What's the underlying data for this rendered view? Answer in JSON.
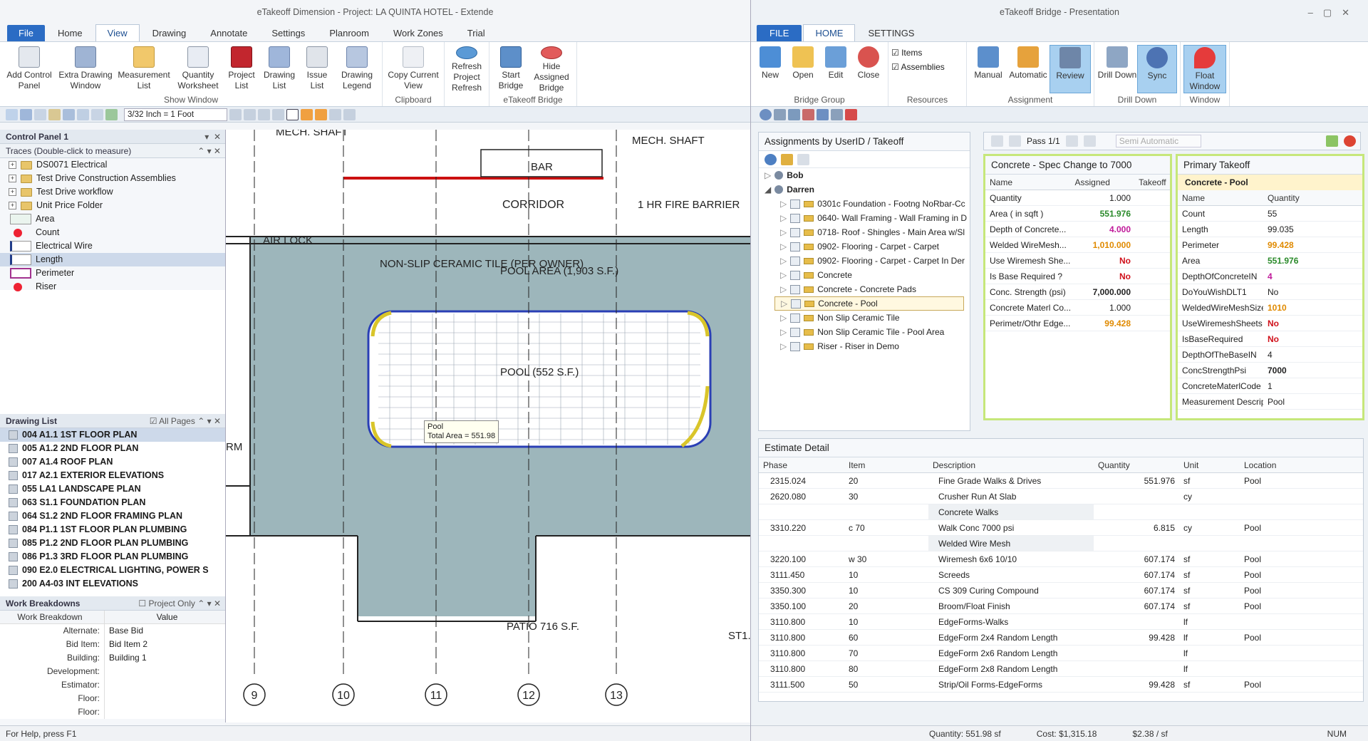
{
  "left_window": {
    "title": "eTakeoff Dimension - Project: LA QUINTA HOTEL - Extende",
    "tabs": [
      "File",
      "Home",
      "View",
      "Drawing",
      "Annotate",
      "Settings",
      "Planroom",
      "Work Zones",
      "Trial"
    ],
    "active_tab": "View",
    "ribbon": {
      "show_window": {
        "label": "Show Window",
        "buttons": [
          "Add Control Panel",
          "Extra Drawing Window",
          "Measurement List",
          "Quantity Worksheet",
          "Project List",
          "Drawing List",
          "Issue List",
          "Drawing Legend"
        ]
      },
      "clipboard": {
        "label": "Clipboard",
        "buttons": [
          "Copy Current View"
        ]
      },
      "refresh": {
        "label": "Refresh",
        "buttons": [
          "Refresh Project Refresh"
        ]
      },
      "etakeoff_bridge": {
        "label": "eTakeoff Bridge",
        "buttons": [
          "Start Bridge",
          "Hide Assigned Bridge"
        ]
      }
    },
    "scale": "3/32 Inch = 1 Foot",
    "control_panel": {
      "title": "Control Panel 1"
    },
    "traces": {
      "title": "Traces (Double-click to measure)",
      "folders": [
        "DS0071 Electrical",
        "Test Drive Construction Assemblies",
        "Test Drive workflow",
        "Unit Price Folder"
      ],
      "items": [
        {
          "label": "Area",
          "kind": "area"
        },
        {
          "label": "Count",
          "kind": "count"
        },
        {
          "label": "Electrical Wire",
          "kind": "line"
        },
        {
          "label": "Length",
          "kind": "line"
        },
        {
          "label": "Perimeter",
          "kind": "perimeter"
        },
        {
          "label": "Riser",
          "kind": "count"
        }
      ]
    },
    "drawing_list": {
      "title": "Drawing List",
      "all_pages": "All Pages",
      "items": [
        "004 A1.1 1ST FLOOR PLAN",
        "005 A1.2 2ND FLOOR PLAN",
        "007 A1.4 ROOF PLAN",
        "017 A2.1 EXTERIOR ELEVATIONS",
        "055 LA1 LANDSCAPE PLAN",
        "063 S1.1 FOUNDATION PLAN",
        "064 S1.2 2ND FLOOR FRAMING PLAN",
        "084 P1.1 1ST FLOOR PLAN PLUMBING",
        "085 P1.2 2ND FLOOR PLAN PLUMBING",
        "086 P1.3 3RD FLOOR PLAN PLUMBING",
        "090 E2.0 ELECTRICAL LIGHTING, POWER S",
        "200 A4-03 INT ELEVATIONS"
      ]
    },
    "work_breakdowns": {
      "title": "Work Breakdowns",
      "project_only": "Project Only",
      "col1": "Work Breakdown",
      "col2": "Value",
      "rows": [
        [
          "Alternate:",
          "Base Bid"
        ],
        [
          "Bid Item:",
          "Bid Item 2"
        ],
        [
          "Building:",
          "Building 1"
        ],
        [
          "Development:",
          ""
        ],
        [
          "Estimator:",
          ""
        ],
        [
          "Floor:",
          ""
        ],
        [
          "Floor:",
          ""
        ]
      ]
    },
    "status": "For Help, press F1",
    "drawing": {
      "labels": {
        "mech_shaft_l": "MECH. SHAFT",
        "mech_shaft_r": "MECH. SHAFT",
        "bar": "BAR",
        "corridor": "CORRIDOR",
        "fire_barrier": "1 HR FIRE BARRIER",
        "air_lock": "AIR LOCK",
        "non_slip": "NON-SLIP CERAMIC TILE (PER OWNER)",
        "pool_area": "POOL AREA (1,903 S.F.)",
        "pool": "POOL (552 S.F.)",
        "patio": "PATIO 716 S.F.",
        "rm": "RM",
        "st": "ST1."
      },
      "tooltip": {
        "name": "Pool",
        "value": "Total Area = 551.98"
      },
      "grid_bubbles": [
        "9",
        "10",
        "11",
        "12",
        "13"
      ]
    }
  },
  "right_window": {
    "title": "eTakeoff Bridge - Presentation",
    "tabs": [
      "FILE",
      "HOME",
      "SETTINGS"
    ],
    "ribbon": {
      "bridge_group": {
        "label": "Bridge Group",
        "buttons": [
          "New",
          "Open",
          "Edit",
          "Close"
        ]
      },
      "resources": {
        "label": "Resources",
        "checks": [
          "Items",
          "Assemblies"
        ]
      },
      "assignment": {
        "label": "Assignment",
        "buttons": [
          "Manual",
          "Automatic",
          "Review"
        ]
      },
      "drill_down": {
        "label": "Drill Down",
        "buttons": [
          "Drill Down",
          "Sync"
        ]
      },
      "window": {
        "label": "Window",
        "buttons": [
          "Float Window"
        ]
      }
    },
    "assignments": {
      "title": "Assignments by UserID / Takeoff",
      "users": [
        "Bob",
        "Darren"
      ],
      "items": [
        "0301c   Foundation - Footng NoRbar-Cc",
        "0640-   Wall Framing - Wall Framing in D",
        "0718-   Roof - Shingles - Main Area w/Sl",
        "0902-   Flooring - Carpet - Carpet",
        "0902-   Flooring - Carpet - Carpet In Der",
        "Concrete",
        "Concrete  - Concrete Pads",
        "Concrete  - Pool",
        "Non Slip Ceramic Tile",
        "Non Slip Ceramic Tile - Pool Area",
        "Riser - Riser in Demo"
      ],
      "selected": "Concrete  - Pool"
    },
    "pass": "Pass 1/1",
    "semi_auto": "Semi Automatic",
    "spec": {
      "title": "Concrete - Spec Change to 7000",
      "cols": [
        "Name",
        "Assigned",
        "Takeoff"
      ],
      "rows": [
        [
          "Quantity",
          "1.000",
          ""
        ],
        [
          "Area   ( in sqft )",
          "551.976",
          ""
        ],
        [
          "Depth of Concrete...",
          "4.000",
          ""
        ],
        [
          "Welded WireMesh...",
          "1,010.000",
          ""
        ],
        [
          "Use Wiremesh She...",
          "No",
          ""
        ],
        [
          "Is Base Required ?",
          "No",
          ""
        ],
        [
          "Conc. Strength (psi)",
          "7,000.000",
          ""
        ],
        [
          "Concrete Materl Co...",
          "1.000",
          ""
        ],
        [
          "Perimetr/Othr Edge...",
          "99.428",
          ""
        ]
      ]
    },
    "primary": {
      "title": "Primary Takeoff",
      "sub": "Concrete  - Pool",
      "cols": [
        "Name",
        "Quantity"
      ],
      "rows": [
        [
          "Count",
          "55"
        ],
        [
          "Length",
          "99.035"
        ],
        [
          "Perimeter",
          "99.428"
        ],
        [
          "Area",
          "551.976"
        ],
        [
          "DepthOfConcreteIN",
          "4"
        ],
        [
          "DoYouWishDLT1",
          "No"
        ],
        [
          "WeldedWireMeshSize",
          "1010"
        ],
        [
          "UseWiremeshSheets",
          "No"
        ],
        [
          "IsBaseRequired",
          "No"
        ],
        [
          "DepthOfTheBaseIN",
          "4"
        ],
        [
          "ConcStrengthPsi",
          "7000"
        ],
        [
          "ConcreteMaterlCode",
          "1"
        ],
        [
          "Measurement Descrip",
          "Pool"
        ]
      ]
    },
    "estimate": {
      "title": "Estimate Detail",
      "cols": [
        "Phase",
        "Item",
        "Description",
        "Quantity",
        "Unit",
        "Location"
      ],
      "rows": [
        [
          "2315.024",
          "20",
          "Fine Grade Walks & Drives",
          "551.976",
          "sf",
          "Pool"
        ],
        [
          "2620.080",
          "30",
          "Crusher Run At Slab",
          "",
          "cy",
          ""
        ],
        [
          "",
          "",
          "Concrete Walks",
          "",
          "",
          ""
        ],
        [
          "3310.220",
          "c 70",
          "Walk Conc 7000 psi",
          "6.815",
          "cy",
          "Pool"
        ],
        [
          "",
          "",
          "Welded Wire Mesh",
          "",
          "",
          ""
        ],
        [
          "3220.100",
          "w 30",
          "Wiremesh 6x6 10/10",
          "607.174",
          "sf",
          "Pool"
        ],
        [
          "3111.450",
          "10",
          "Screeds",
          "607.174",
          "sf",
          "Pool"
        ],
        [
          "3350.300",
          "10",
          "CS 309 Curing Compound",
          "607.174",
          "sf",
          "Pool"
        ],
        [
          "3350.100",
          "20",
          "Broom/Float Finish",
          "607.174",
          "sf",
          "Pool"
        ],
        [
          "3110.800",
          "10",
          "EdgeForms-Walks",
          "",
          "lf",
          ""
        ],
        [
          "3110.800",
          "60",
          "EdgeForm 2x4 Random Length",
          "99.428",
          "lf",
          "Pool"
        ],
        [
          "3110.800",
          "70",
          "EdgeForm 2x6 Random Length",
          "",
          "lf",
          ""
        ],
        [
          "3110.800",
          "80",
          "EdgeForm 2x8 Random Length",
          "",
          "lf",
          ""
        ],
        [
          "3111.500",
          "50",
          "Strip/Oil Forms-EdgeForms",
          "99.428",
          "sf",
          "Pool"
        ]
      ]
    },
    "status": {
      "quantity": "Quantity: 551.98 sf",
      "cost": "Cost: $1,315.18",
      "rate": "$2.38 / sf",
      "num": "NUM"
    }
  }
}
